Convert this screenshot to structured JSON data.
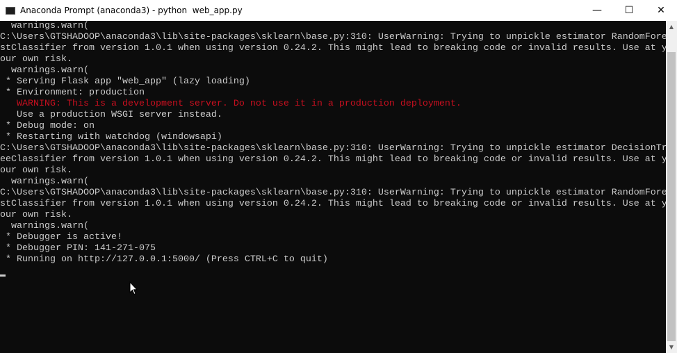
{
  "window": {
    "title": "Anaconda Prompt (anaconda3) - python  web_app.py",
    "minimize_glyph": "—",
    "maximize_glyph": "☐",
    "close_glyph": "✕",
    "icon": "terminal-icon"
  },
  "console": {
    "lines": [
      "  warnings.warn(",
      "C:\\Users\\GTSHADOOP\\anaconda3\\lib\\site-packages\\sklearn\\base.py:310: UserWarning: Trying to unpickle estimator RandomFore",
      "stClassifier from version 1.0.1 when using version 0.24.2. This might lead to breaking code or invalid results. Use at y",
      "our own risk.",
      "  warnings.warn(",
      " * Serving Flask app \"web_app\" (lazy loading)",
      " * Environment: production",
      "   WARNING: This is a development server. Do not use it in a production deployment.",
      "   Use a production WSGI server instead.",
      " * Debug mode: on",
      " * Restarting with watchdog (windowsapi)",
      "C:\\Users\\GTSHADOOP\\anaconda3\\lib\\site-packages\\sklearn\\base.py:310: UserWarning: Trying to unpickle estimator DecisionTr",
      "eeClassifier from version 1.0.1 when using version 0.24.2. This might lead to breaking code or invalid results. Use at y",
      "our own risk.",
      "  warnings.warn(",
      "C:\\Users\\GTSHADOOP\\anaconda3\\lib\\site-packages\\sklearn\\base.py:310: UserWarning: Trying to unpickle estimator RandomFore",
      "stClassifier from version 1.0.1 when using version 0.24.2. This might lead to breaking code or invalid results. Use at y",
      "our own risk.",
      "  warnings.warn(",
      " * Debugger is active!",
      " * Debugger PIN: 141-271-075",
      " * Running on http://127.0.0.1:5000/ (Press CTRL+C to quit)"
    ],
    "warning_line_index": 7,
    "colors": {
      "background": "#0c0c0c",
      "text": "#cccccc",
      "warning": "#c50f1f"
    }
  },
  "scrollbar": {
    "up_glyph": "▲",
    "down_glyph": "▼"
  }
}
